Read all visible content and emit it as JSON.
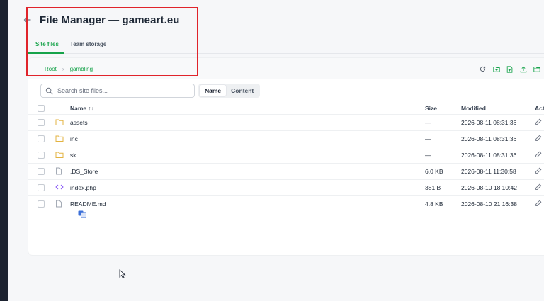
{
  "header": {
    "title": "File Manager — gameart.eu"
  },
  "tabs": [
    {
      "label": "Site files"
    },
    {
      "label": "Team storage"
    }
  ],
  "breadcrumb": {
    "root": "Root",
    "current": "gambling"
  },
  "search": {
    "placeholder": "Search site files..."
  },
  "toggle": {
    "name": "Name",
    "content": "Content"
  },
  "table": {
    "headers": {
      "name": "Name ↑↓",
      "size": "Size",
      "modified": "Modified",
      "actions": "Actions"
    },
    "rows": [
      {
        "name": "assets",
        "type": "folder",
        "size": "—",
        "modified": "2026-08-11 08:31:36"
      },
      {
        "name": "inc",
        "type": "folder",
        "size": "—",
        "modified": "2026-08-11 08:31:36"
      },
      {
        "name": "sk",
        "type": "folder",
        "size": "—",
        "modified": "2026-08-11 08:31:36"
      },
      {
        "name": ".DS_Store",
        "type": "file",
        "size": "6.0 KB",
        "modified": "2026-08-11 11:30:58"
      },
      {
        "name": "index.php",
        "type": "code",
        "size": "381 B",
        "modified": "2026-08-10 18:10:42"
      },
      {
        "name": "README.md",
        "type": "file",
        "size": "4.8 KB",
        "modified": "2026-08-10 21:16:38"
      }
    ]
  },
  "colors": {
    "accent": "#16a34a",
    "folder": "#e3b341",
    "code": "#8b5cf6",
    "highlight": "#e0242b",
    "delete": "#dc2626",
    "rename": "#3b82f6"
  },
  "icons": [
    "back-arrow-icon",
    "refresh-icon",
    "new-folder-icon",
    "new-file-icon",
    "upload-icon",
    "open-folder-icon",
    "search-icon",
    "folder-icon",
    "file-icon",
    "code-icon",
    "edit-icon",
    "delete-icon"
  ]
}
